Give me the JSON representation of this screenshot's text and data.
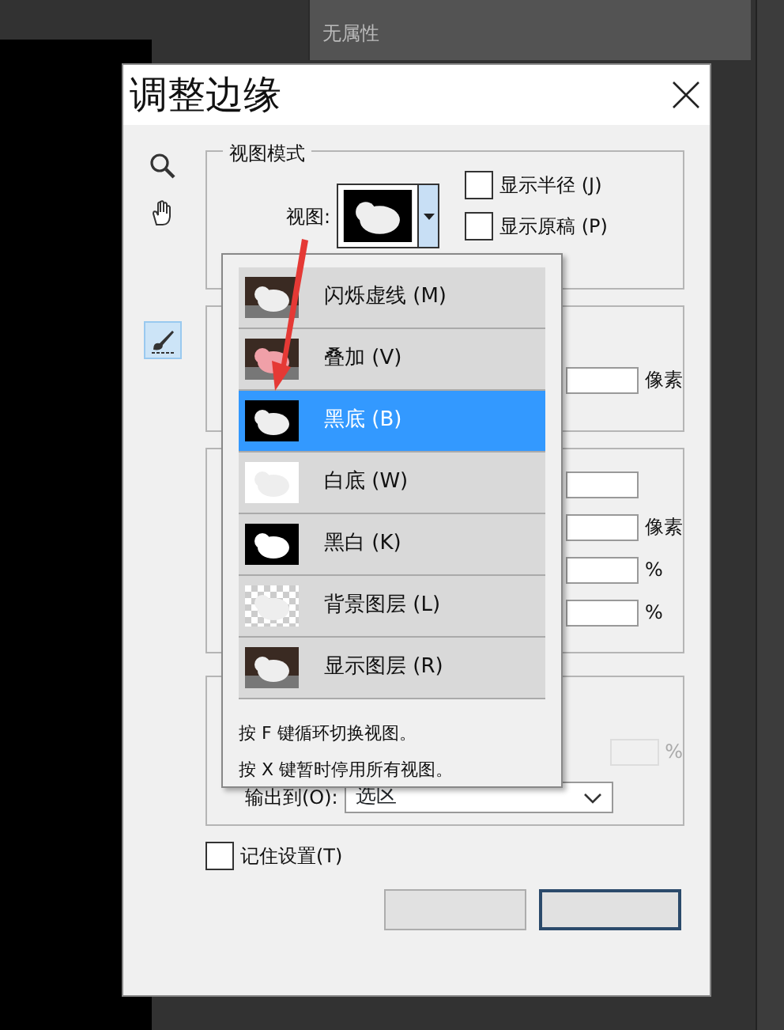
{
  "properties_panel": {
    "label": "无属性"
  },
  "dialog": {
    "title": "调整边缘",
    "tools": [
      {
        "kind": "zoom",
        "selected": false
      },
      {
        "kind": "hand",
        "selected": false
      },
      {
        "kind": "brush",
        "selected": true
      }
    ],
    "view_mode": {
      "legend": "视图模式",
      "view_label": "视图:",
      "checkboxes": [
        {
          "label": "显示半径 (J)",
          "checked": false
        },
        {
          "label": "显示原稿 (P)",
          "checked": false
        }
      ]
    },
    "edge_detection": {
      "unit": "像素"
    },
    "adjust_edge": {
      "fields": [
        {
          "kind": "blank"
        },
        {
          "kind": "unit",
          "unit": "像素"
        },
        {
          "kind": "unit",
          "unit": "%"
        },
        {
          "kind": "unit",
          "unit": "%"
        }
      ]
    },
    "output": {
      "amount_unit": "%",
      "label": "输出到(O):",
      "value": "选区"
    },
    "remember": {
      "label": "记住设置(T)",
      "checked": false
    },
    "buttons": [
      {
        "kind": "secondary"
      },
      {
        "kind": "primary"
      }
    ]
  },
  "view_menu": {
    "items": [
      {
        "label": "闪烁虚线 (M)",
        "kind": "photo",
        "selected": false
      },
      {
        "label": "叠加 (V)",
        "kind": "overlay",
        "selected": false
      },
      {
        "label": "黑底 (B)",
        "kind": "black",
        "selected": true
      },
      {
        "label": "白底 (W)",
        "kind": "white",
        "selected": false
      },
      {
        "label": "黑白 (K)",
        "kind": "mask",
        "selected": false
      },
      {
        "label": "背景图层 (L)",
        "kind": "checker",
        "selected": false
      },
      {
        "label": "显示图层 (R)",
        "kind": "photo",
        "selected": false
      }
    ],
    "hints": [
      "按 F 键循环切换视图。",
      "按 X 键暂时停用所有视图。"
    ]
  }
}
